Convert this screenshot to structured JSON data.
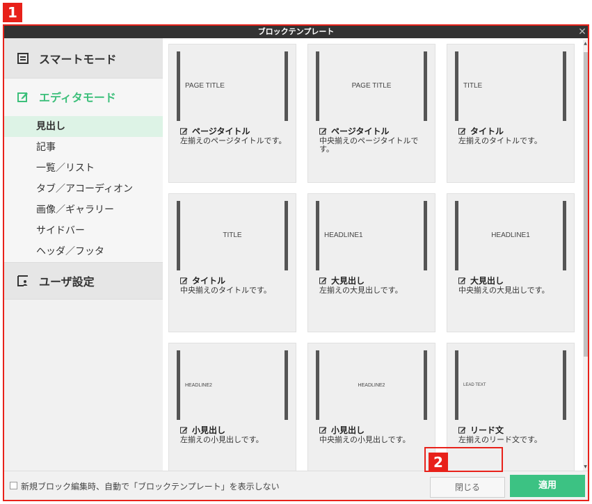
{
  "badges": {
    "one": "1",
    "two": "2"
  },
  "dialog": {
    "title": "ブロックテンプレート",
    "close_glyph": "✕"
  },
  "sidebar": {
    "smart_mode": "スマートモード",
    "editor_mode": "エディタモード",
    "sub_items": [
      "見出し",
      "記事",
      "一覧／リスト",
      "タブ／アコーディオン",
      "画像／ギャラリー",
      "サイドバー",
      "ヘッダ／フッタ"
    ],
    "user_settings": "ユーザ設定"
  },
  "templates": [
    {
      "preview": "PAGE TITLE",
      "name": "ページタイトル",
      "desc": "左揃えのページタイトルです。"
    },
    {
      "preview": "PAGE TITLE",
      "name": "ページタイトル",
      "desc": "中央揃えのページタイトルです。"
    },
    {
      "preview": "TITLE",
      "name": "タイトル",
      "desc": "左揃えのタイトルです。"
    },
    {
      "preview": "TITLE",
      "name": "タイトル",
      "desc": "中央揃えのタイトルです。"
    },
    {
      "preview": "HEADLINE1",
      "name": "大見出し",
      "desc": "左揃えの大見出しです。"
    },
    {
      "preview": "HEADLINE1",
      "name": "大見出し",
      "desc": "中央揃えの大見出しです。"
    },
    {
      "preview": "HEADLINE2",
      "name": "小見出し",
      "desc": "左揃えの小見出しです。"
    },
    {
      "preview": "HEADLINE2",
      "name": "小見出し",
      "desc": "中央揃えの小見出しです。"
    },
    {
      "preview": "LEAD TEXT",
      "name": "リード文",
      "desc": "左揃えのリード文です。"
    }
  ],
  "footer": {
    "checkbox_label": "新規ブロック編集時、自動で「ブロックテンプレート」を表示しない",
    "close_label": "閉じる",
    "apply_label": "適用"
  },
  "colors": {
    "accent": "#3cc283",
    "highlight": "#e8211a",
    "titlebar": "#333333"
  }
}
